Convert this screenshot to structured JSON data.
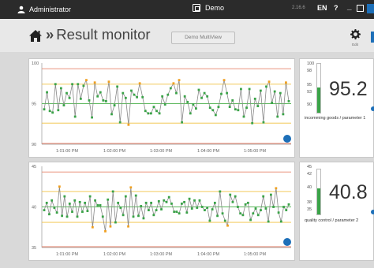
{
  "titlebar": {
    "user": "Administrator",
    "window_title": "Demo",
    "version": "2.16.6",
    "language": "EN",
    "help": "?",
    "minimize": "_"
  },
  "header": {
    "separator": "»",
    "title": "Result monitor",
    "multiview_label": "Demo MultiView",
    "edit_label": "Edit"
  },
  "colors": {
    "accent": "#1d6fb8",
    "green_point": "#3aa348",
    "orange_point": "#f0a020",
    "limit_red": "#e8836b",
    "limit_yellow": "#f0c040",
    "center_green": "#5cb85c"
  },
  "chart_data": [
    {
      "type": "line",
      "ylim": [
        90,
        100
      ],
      "yticks": [
        "100",
        "95",
        "90"
      ],
      "limits": {
        "upper_red": 99.3,
        "upper_yellow": 97.4,
        "center": 95,
        "lower_yellow": 92.6
      },
      "x_ticks": [
        "1:01:00 PM",
        "1:02:00 PM",
        "1:03:00 PM",
        "1:04:00 PM",
        "1:05:00 PM"
      ],
      "values": [
        94.3,
        96.4,
        94.1,
        93.9,
        97.4,
        94.2,
        96.9,
        94.8,
        96.3,
        95.7,
        97.4,
        93.4,
        97.4,
        95.6,
        97.2,
        97.9,
        95.4,
        93.3,
        97.6,
        95.9,
        96.4,
        95.4,
        95.3,
        97.7,
        93.7,
        94.8,
        97.1,
        92.7,
        96.3,
        95.7,
        92.4,
        96.6,
        96.1,
        95.8,
        97.5,
        95.8,
        94.1,
        93.8,
        93.8,
        94.6,
        94.1,
        93.8,
        95.9,
        94.9,
        96.1,
        96.9,
        97.5,
        96.3,
        97.9,
        92.7,
        95.9,
        95.2,
        93.8,
        94.9,
        94.4,
        96.7,
        95.7,
        96.3,
        95.9,
        94.5,
        94.2,
        93.6,
        94.6,
        96.2,
        97.9,
        96.3,
        94.6,
        95.4,
        94.3,
        94.2,
        96.8,
        93.4,
        94.5,
        96.8,
        92.6,
        95.6,
        94.7,
        96.6,
        92.7,
        97.1,
        97.7,
        95.1,
        96.5,
        93.4,
        96.3,
        93.7,
        97.6,
        95.3
      ]
    },
    {
      "type": "line",
      "ylim": [
        35,
        45
      ],
      "yticks": [
        "45",
        "40",
        "35"
      ],
      "limits": {
        "upper_red": 44.3,
        "upper_yellow": 41.9,
        "center": 40,
        "lower_yellow": 38.1
      },
      "x_ticks": [
        "1:01:00 PM",
        "1:02:00 PM",
        "1:03:00 PM",
        "1:04:00 PM",
        "1:05:00 PM"
      ],
      "values": [
        39.6,
        40.5,
        39.1,
        40.8,
        39.9,
        39.3,
        42.5,
        38.9,
        41.3,
        38.8,
        40.4,
        39.4,
        40.8,
        38.8,
        40.6,
        39.4,
        40.5,
        39.5,
        41.3,
        37.5,
        40.8,
        40.2,
        40.2,
        38.8,
        37.0,
        40.9,
        37.6,
        41.9,
        38.1,
        40.5,
        39.9,
        39.0,
        41.3,
        37.6,
        42.4,
        38.8,
        41.4,
        38.9,
        40.1,
        38.6,
        40.5,
        39.6,
        40.5,
        39.0,
        39.6,
        40.7,
        39.7,
        40.8,
        40.6,
        41.2,
        40.4,
        39.4,
        39.4,
        39.2,
        40.4,
        40.6,
        39.3,
        41.0,
        39.8,
        40.8,
        39.9,
        40.8,
        40.0,
        39.6,
        39.9,
        38.3,
        39.7,
        40.5,
        38.9,
        41.9,
        39.2,
        38.3,
        37.7,
        41.5,
        40.6,
        41.3,
        40.0,
        39.2,
        39.0,
        40.3,
        40.5,
        38.4,
        39.2,
        39.8,
        39.0,
        39.6,
        41.3,
        39.8,
        38.2,
        41.5,
        40.0,
        42.3,
        39.3,
        38.2,
        40.0,
        39.6,
        40.3
      ]
    }
  ],
  "gauges": [
    {
      "value": "95.2",
      "label": "incomming goods / parameter 1",
      "ticks": [
        "100",
        "98",
        "95",
        "93",
        "90"
      ],
      "fill_fraction": 0.52
    },
    {
      "value": "40.8",
      "label": "quality control / parameter 2",
      "ticks": [
        "45",
        "42",
        "40",
        "38",
        "35"
      ],
      "fill_fraction": 0.58
    }
  ]
}
